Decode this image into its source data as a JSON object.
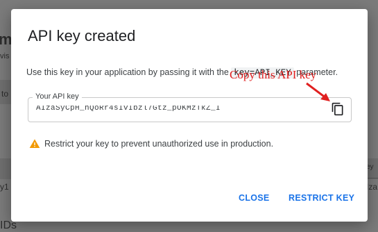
{
  "background": {
    "title_fragment": "m",
    "subtitle_fragment": "vis",
    "row_fragment_left": "to",
    "row_fragment_right": "ey",
    "cell_fragment_left": "y1",
    "cell_fragment_right": "Iza",
    "heading_fragment": "IDs"
  },
  "dialog": {
    "title": "API key created",
    "desc_before": "Use this key in your application by passing it with the ",
    "desc_code": "key=API_KEY",
    "desc_after": " parameter.",
    "field_label": "Your API key",
    "field_value": "AIzaSyCpH_hQoRr4sIvIbzl7Gtz_pOKMzTkZ_I",
    "copy_icon": "content-copy-icon",
    "warning_icon": "warning-triangle-icon",
    "warning_text": "Restrict your key to prevent unauthorized use in production.",
    "close_label": "CLOSE",
    "restrict_label": "RESTRICT KEY"
  },
  "annotation": {
    "text": "Copy this API key",
    "color": "#e02020"
  },
  "colors": {
    "accent": "#1a73e8",
    "warning": "#f29900",
    "overlay": "#7b7b7b"
  }
}
